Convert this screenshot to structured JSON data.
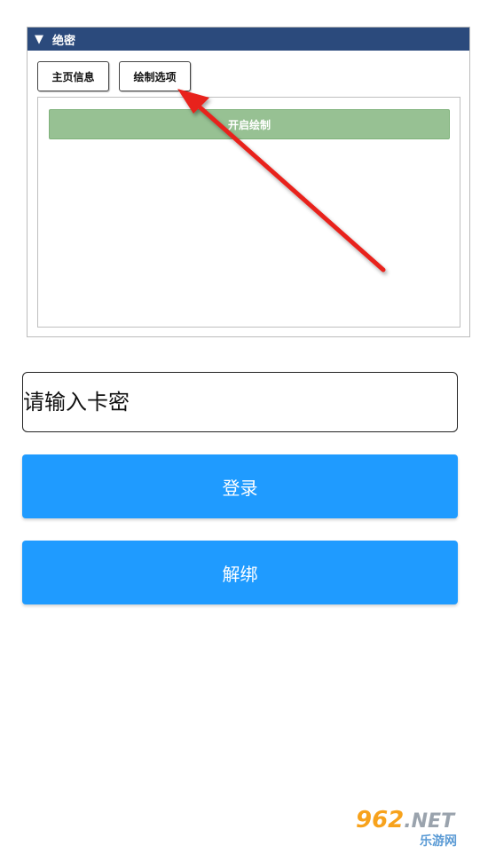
{
  "panel": {
    "title": "绝密",
    "collapse_glyph": "▼",
    "tabs": [
      {
        "label": "主页信息"
      },
      {
        "label": "绘制选项"
      }
    ],
    "start_button_label": "开启绘制"
  },
  "form": {
    "card_key_placeholder": "请输入卡密",
    "login_label": "登录",
    "unbind_label": "解绑"
  },
  "watermark": {
    "brand_number": "962",
    "brand_suffix": ".NET",
    "brand_name": "乐游网"
  },
  "colors": {
    "panel_header": "#2b4a7c",
    "start_button": "#97c193",
    "primary_button": "#1f9bff",
    "arrow": "#e8201a"
  },
  "icons": {
    "collapse": "triangle-down-icon",
    "annotation": "red-arrow-icon"
  }
}
